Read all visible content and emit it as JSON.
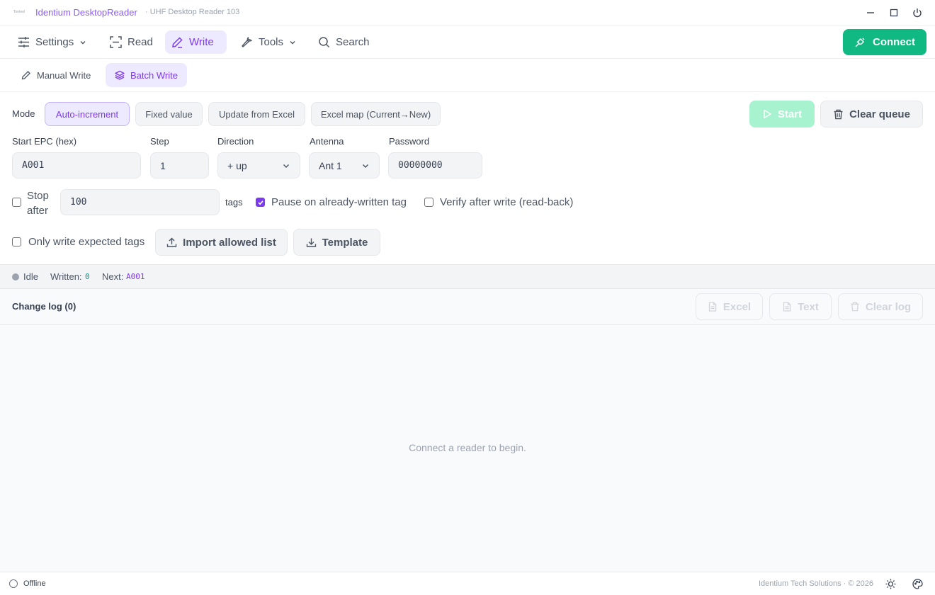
{
  "titlebar": {
    "logo_text": "Tonteel",
    "app_name": "Identium DesktopReader",
    "subtitle": "· UHF Desktop Reader 103",
    "controls": [
      "minimize-icon",
      "maximize-icon",
      "power-icon"
    ]
  },
  "nav": {
    "settings": "Settings",
    "read": "Read",
    "write": "Write",
    "tools": "Tools",
    "search": "Search",
    "connect": "Connect",
    "active": "Write"
  },
  "subnav": {
    "manual_write": "Manual Write",
    "batch_write": "Batch Write",
    "active": "Batch Write"
  },
  "mode": {
    "label": "Mode",
    "options": [
      "Auto-increment",
      "Fixed value",
      "Update from Excel",
      "Excel map (Current→New)"
    ],
    "selected": "Auto-increment"
  },
  "actions": {
    "start": "Start",
    "clear_queue": "Clear queue"
  },
  "fields": {
    "start_epc": {
      "label": "Start EPC (hex)",
      "value": "A001"
    },
    "step": {
      "label": "Step",
      "value": "1"
    },
    "direction": {
      "label": "Direction",
      "value": "+ up"
    },
    "antenna": {
      "label": "Antenna",
      "value": "Ant 1"
    },
    "password": {
      "label": "Password",
      "value": "00000000"
    }
  },
  "options": {
    "stop_after": {
      "label_line1": "Stop",
      "label_line2": "after",
      "checked": false,
      "value": "100",
      "unit": "tags"
    },
    "pause_on_written": {
      "label": "Pause on already-written tag",
      "checked": true
    },
    "verify_after_write": {
      "label": "Verify after write (read-back)",
      "checked": false
    },
    "only_expected": {
      "label": "Only write expected tags",
      "checked": false
    },
    "import_allowed": "Import allowed list",
    "template": "Template"
  },
  "status": {
    "state": "Idle",
    "written_label": "Written:",
    "written_value": "0",
    "next_label": "Next:",
    "next_value": "A001"
  },
  "log": {
    "title": "Change log (0)",
    "excel": "Excel",
    "text": "Text",
    "clear_log": "Clear log",
    "empty_message": "Connect a reader to begin."
  },
  "footer": {
    "connection": "Offline",
    "copyright": "Identium Tech Solutions · © 2026"
  },
  "colors": {
    "accent": "#7c3aed",
    "accent_bg": "#ede9fe",
    "connect": "#10b981",
    "start_disabled": "#a7f3d0"
  }
}
